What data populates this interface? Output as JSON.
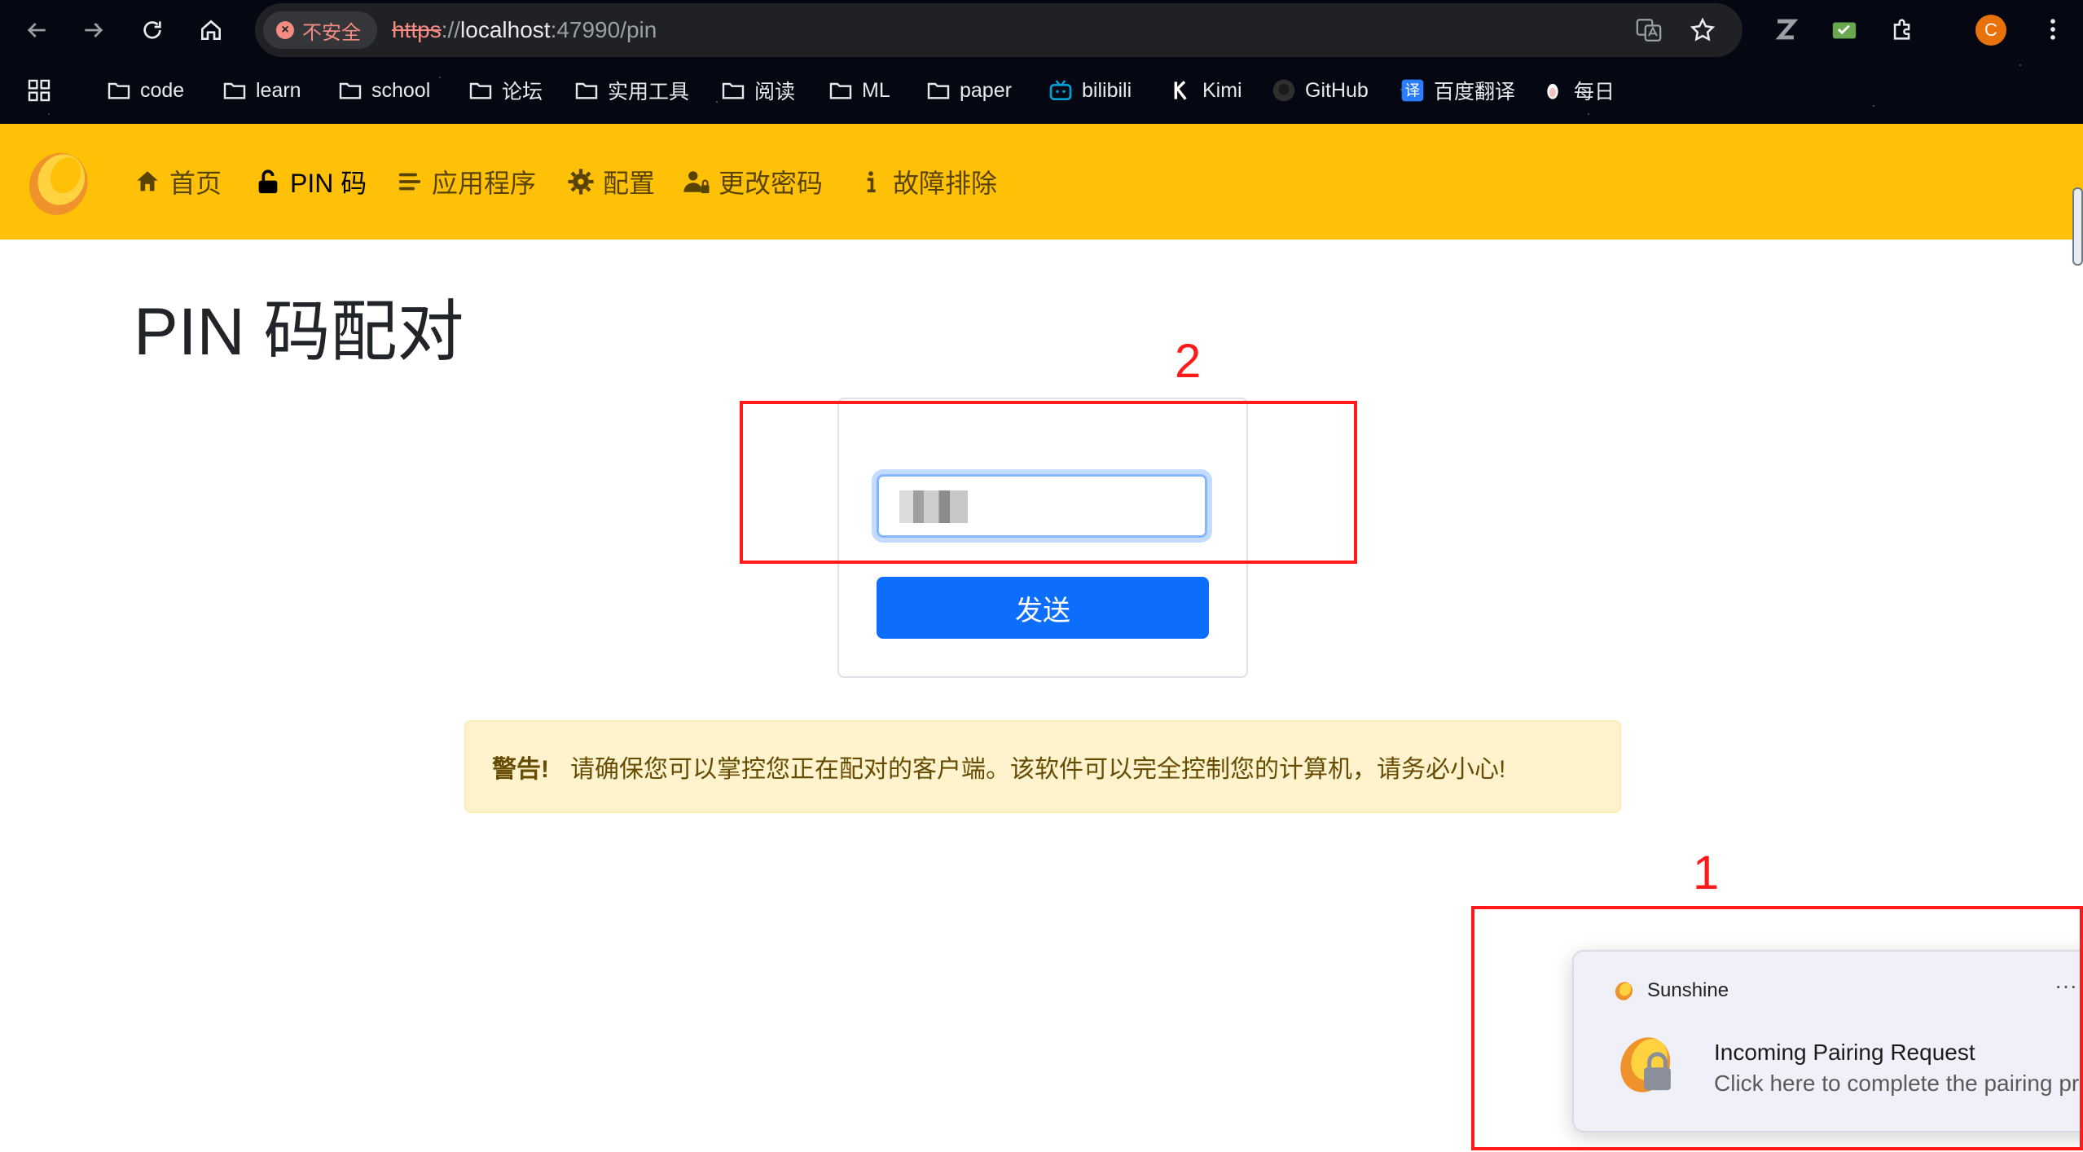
{
  "browser": {
    "security_label": "不安全",
    "url_protocol": "https",
    "url_sep": "://",
    "url_host": "localhost",
    "url_rest": ":47990/pin",
    "profile_initial": "C",
    "bookmarks": [
      {
        "label": "code",
        "icon": "folder-icon"
      },
      {
        "label": "learn",
        "icon": "folder-icon"
      },
      {
        "label": "school",
        "icon": "folder-icon"
      },
      {
        "label": "论坛",
        "icon": "folder-icon"
      },
      {
        "label": "实用工具",
        "icon": "folder-icon"
      },
      {
        "label": "阅读",
        "icon": "folder-icon"
      },
      {
        "label": "ML",
        "icon": "folder-icon"
      },
      {
        "label": "paper",
        "icon": "folder-icon"
      },
      {
        "label": "bilibili",
        "icon": "bilibili-icon"
      },
      {
        "label": "Kimi",
        "icon": "kimi-icon"
      },
      {
        "label": "GitHub",
        "icon": "github-icon"
      },
      {
        "label": "百度翻译",
        "icon": "baidu-translate-icon"
      },
      {
        "label": "每日",
        "icon": "penguin-icon"
      }
    ]
  },
  "nav": {
    "items": [
      {
        "label": "首页",
        "icon": "home-icon"
      },
      {
        "label": "PIN 码",
        "icon": "unlock-icon"
      },
      {
        "label": "应用程序",
        "icon": "list-icon"
      },
      {
        "label": "配置",
        "icon": "gear-icon"
      },
      {
        "label": "更改密码",
        "icon": "user-lock-icon"
      },
      {
        "label": "故障排除",
        "icon": "info-icon"
      }
    ]
  },
  "page": {
    "title": "PIN 码配对",
    "send_label": "发送",
    "warning_strong": "警告!",
    "warning_text": "请确保您可以掌控您正在配对的客户端。该软件可以完全控制您的计算机，请务必小心!"
  },
  "annotations": {
    "label_1": "1",
    "label_2": "2"
  },
  "toast": {
    "app": "Sunshine",
    "more": "···",
    "title": "Incoming Pairing Request",
    "body": "Click here to complete the pairing process"
  },
  "colors": {
    "navbar": "#ffc107",
    "primary": "#0d6efd",
    "warning_bg": "#fff3cd",
    "annotation": "#ff1a1a"
  }
}
